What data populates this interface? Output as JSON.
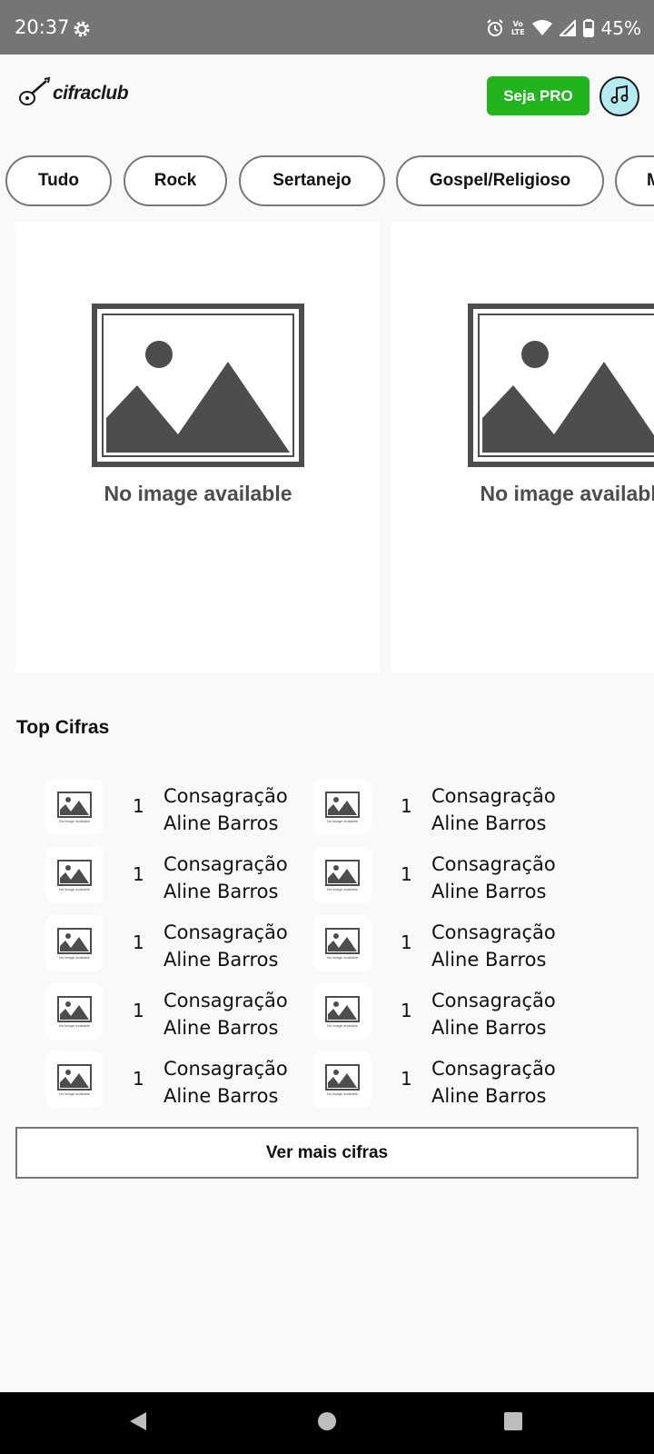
{
  "status_bar": {
    "time": "20:37",
    "network_label": "LTE",
    "battery": "45%",
    "icons": [
      "settings-gear-icon",
      "alarm-icon",
      "volte-icon",
      "wifi-icon",
      "signal-icon",
      "battery-icon"
    ]
  },
  "header": {
    "logo_text": "cifraclub",
    "pro_button": "Seja PRO",
    "music_icon": "music-note-icon",
    "accent_color": "#22b41e"
  },
  "genres": [
    "Tudo",
    "Rock",
    "Sertanejo",
    "Gospel/Religioso",
    "M"
  ],
  "carousel": {
    "cards": [
      {
        "placeholder_text": "No image available"
      },
      {
        "placeholder_text": "No image available"
      }
    ]
  },
  "top_cifras": {
    "title": "Top Cifras",
    "thumb_text": "No image available",
    "items": [
      {
        "rank": "1",
        "song": "Consagração",
        "artist": "Aline Barros"
      },
      {
        "rank": "1",
        "song": "Consagração",
        "artist": "Aline Barros"
      },
      {
        "rank": "1",
        "song": "Consagração",
        "artist": "Aline Barros"
      },
      {
        "rank": "1",
        "song": "Consagração",
        "artist": "Aline Barros"
      },
      {
        "rank": "1",
        "song": "Consagração",
        "artist": "Aline Barros"
      },
      {
        "rank": "1",
        "song": "Consagração",
        "artist": "Aline Barros"
      },
      {
        "rank": "1",
        "song": "Consagração",
        "artist": "Aline Barros"
      },
      {
        "rank": "1",
        "song": "Consagração",
        "artist": "Aline Barros"
      },
      {
        "rank": "1",
        "song": "Consagração",
        "artist": "Aline Barros"
      },
      {
        "rank": "1",
        "song": "Consagração",
        "artist": "Aline Barros"
      }
    ],
    "more_button": "Ver mais cifras"
  },
  "nav": {
    "buttons": [
      "back-icon",
      "home-icon",
      "recents-icon"
    ]
  }
}
